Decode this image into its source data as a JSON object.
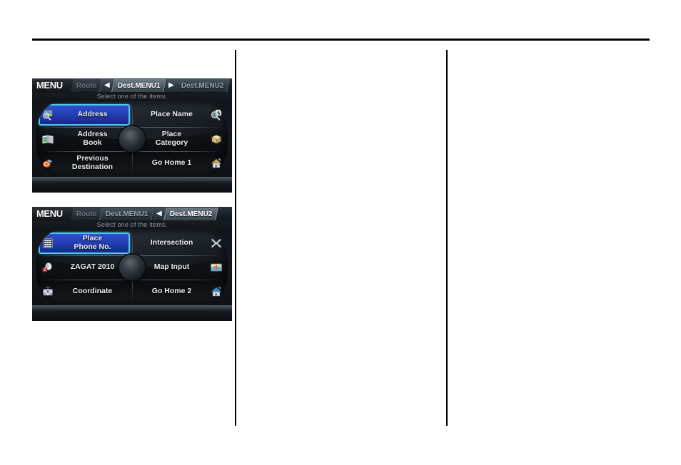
{
  "page": {
    "background": "#ffffff",
    "rule_color": "#000000"
  },
  "screens": [
    {
      "name": "dest-menu-1",
      "menu_word": "MENU",
      "subtitle": "Select one of the items.",
      "tabs": [
        {
          "label": "Route",
          "state": "dim"
        },
        {
          "label": "Dest.MENU1",
          "state": "active"
        },
        {
          "label": "Dest.MENU2",
          "state": "normal"
        }
      ],
      "arrows": {
        "before_active": "◀",
        "after_active": "▶"
      },
      "items": [
        {
          "label": "Address",
          "icon": "magnifier-photo-icon",
          "side": "left",
          "selected": true
        },
        {
          "label": "Place Name",
          "icon": "magnifier-letter-icon",
          "side": "right",
          "selected": false
        },
        {
          "label": "Address\nBook",
          "icon": "open-book-icon",
          "side": "left",
          "selected": false
        },
        {
          "label": "Place\nCategory",
          "icon": "package-box-icon",
          "side": "right",
          "selected": false
        },
        {
          "label": "Previous\nDestination",
          "icon": "target-marker-icon",
          "side": "left",
          "selected": false
        },
        {
          "label": "Go Home 1",
          "icon": "house-tan-icon",
          "side": "right",
          "selected": false
        }
      ]
    },
    {
      "name": "dest-menu-2",
      "menu_word": "MENU",
      "subtitle": "Select one of the items.",
      "tabs": [
        {
          "label": "Route",
          "state": "dim"
        },
        {
          "label": "Dest.MENU1",
          "state": "normal"
        },
        {
          "label": "Dest.MENU2",
          "state": "active"
        }
      ],
      "arrows": {
        "before_active": "◀",
        "after_active": ""
      },
      "items": [
        {
          "label": "Place\nPhone No.",
          "icon": "keypad-icon",
          "side": "left",
          "selected": true
        },
        {
          "label": "Intersection",
          "icon": "crossroads-icon",
          "side": "right",
          "selected": false
        },
        {
          "label": "ZAGAT 2010",
          "icon": "zagat-logo-icon",
          "side": "left",
          "selected": false
        },
        {
          "label": "Map Input",
          "icon": "map-thumb-icon",
          "side": "right",
          "selected": false
        },
        {
          "label": "Coordinate",
          "icon": "crosshair-icon",
          "side": "left",
          "selected": false
        },
        {
          "label": "Go Home 2",
          "icon": "house-blue-icon",
          "side": "right",
          "selected": false
        }
      ]
    }
  ],
  "colors": {
    "selected_border": "#4fc6f0",
    "selected_fill": "#2340b4",
    "tab_active_text": "#ffffff",
    "tab_dim_text": "#6c757d",
    "screen_bg": "#131313"
  }
}
